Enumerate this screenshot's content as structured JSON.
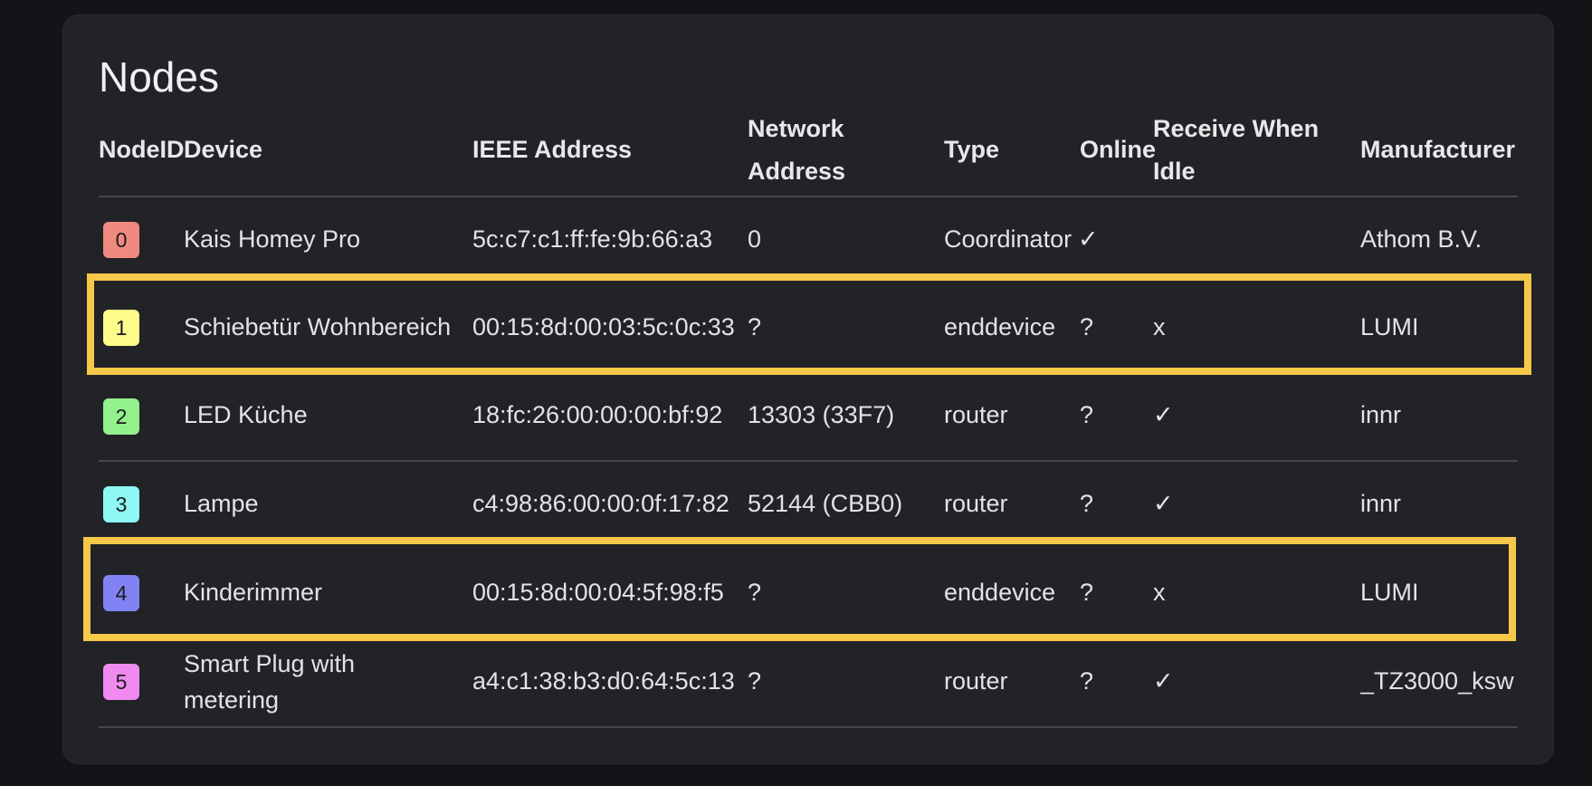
{
  "title": "Nodes",
  "headers": {
    "node_id": "NodeID",
    "device": "Device",
    "ieee": "IEEE Address",
    "network_1": "Network",
    "network_2": "Address",
    "type": "Type",
    "online": "Online",
    "idle_1": "Receive When",
    "idle_2": "Idle",
    "manufacturer": "Manufacturer"
  },
  "rows": [
    {
      "id": "0",
      "color": "#f08a80",
      "device": "Kais Homey Pro",
      "ieee": "5c:c7:c1:ff:fe:9b:66:a3",
      "network": "0",
      "type": "Coordinator",
      "online": "✓",
      "idle": "",
      "manufacturer": "Athom B.V."
    },
    {
      "id": "1",
      "color": "#fdfb8a",
      "device": "Schiebetür Wohnbereich",
      "ieee": "00:15:8d:00:03:5c:0c:33",
      "network": "?",
      "type": "enddevice",
      "online": "?",
      "idle": "x",
      "manufacturer": "LUMI"
    },
    {
      "id": "2",
      "color": "#93f18c",
      "device": "LED Küche",
      "ieee": "18:fc:26:00:00:00:bf:92",
      "network": "13303 (33F7)",
      "type": "router",
      "online": "?",
      "idle": "✓",
      "manufacturer": "innr"
    },
    {
      "id": "3",
      "color": "#8ef9f4",
      "device": "Lampe",
      "ieee": "c4:98:86:00:00:0f:17:82",
      "network": "52144 (CBB0)",
      "type": "router",
      "online": "?",
      "idle": "✓",
      "manufacturer": "innr"
    },
    {
      "id": "4",
      "color": "#8183f5",
      "device": "Kinderimmer",
      "ieee": "00:15:8d:00:04:5f:98:f5",
      "network": "?",
      "type": "enddevice",
      "online": "?",
      "idle": "x",
      "manufacturer": "LUMI"
    },
    {
      "id": "5",
      "color": "#f08af0",
      "device_line1": "Smart Plug with",
      "device_line2": "metering",
      "ieee": "a4:c1:38:b3:d0:64:5c:13",
      "network": "?",
      "type": "router",
      "online": "?",
      "idle": "✓",
      "manufacturer": "_TZ3000_ksw"
    }
  ],
  "highlight_color": "#f5c84a"
}
